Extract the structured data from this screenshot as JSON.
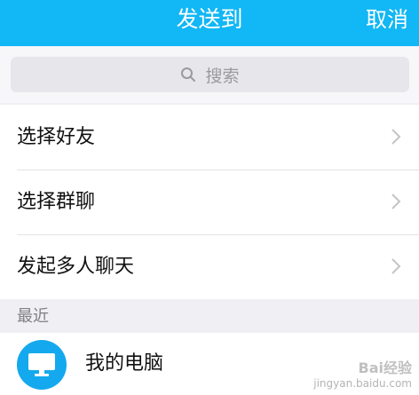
{
  "header": {
    "title": "发送到",
    "cancel_label": "取消"
  },
  "search": {
    "placeholder": "搜索",
    "icon": "search-icon"
  },
  "menu": [
    {
      "label": "选择好友",
      "icon": "chevron-right-icon"
    },
    {
      "label": "选择群聊",
      "icon": "chevron-right-icon"
    },
    {
      "label": "发起多人聊天",
      "icon": "chevron-right-icon"
    }
  ],
  "recent": {
    "section_label": "最近",
    "items": [
      {
        "name": "我的电脑",
        "icon": "monitor-icon"
      }
    ]
  },
  "watermark": {
    "line1": "Bai经验",
    "line2": "jingyan.baidu.com"
  },
  "colors": {
    "accent": "#12b7f5",
    "avatar": "#14a9ee",
    "background": "#efeff4"
  }
}
